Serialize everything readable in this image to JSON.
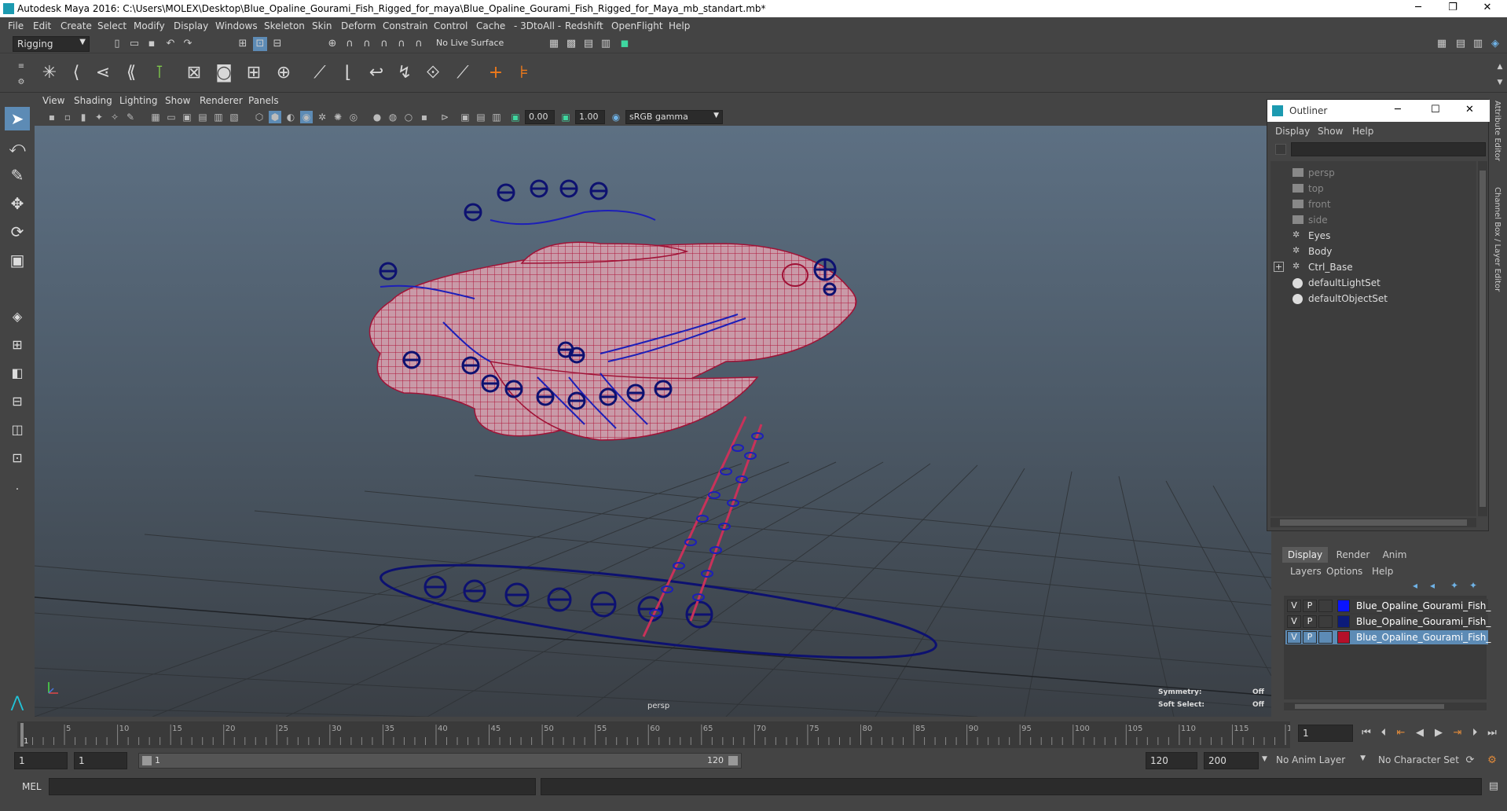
{
  "window": {
    "title": "Autodesk Maya 2016: C:\\Users\\MOLEX\\Desktop\\Blue_Opaline_Gourami_Fish_Rigged_for_maya\\Blue_Opaline_Gourami_Fish_Rigged_for_Maya_mb_standart.mb*",
    "minimize": "─",
    "restore": "❐",
    "close": "✕"
  },
  "menubar": [
    "File",
    "Edit",
    "Create",
    "Select",
    "Modify",
    "Display",
    "Windows",
    "Skeleton",
    "Skin",
    "Deform",
    "Constrain",
    "Control",
    "Cache",
    "- 3DtoAll -",
    "Redshift",
    "OpenFlight",
    "Help"
  ],
  "statusline": {
    "mode": "Rigging",
    "live_surface": "No Live Surface"
  },
  "panel": {
    "menus": [
      "View",
      "Shading",
      "Lighting",
      "Show",
      "Renderer",
      "Panels"
    ],
    "exposure": "0.00",
    "gamma": "1.00",
    "colorspace": "sRGB gamma",
    "camera_label": "persp",
    "symmetry_label": "Symmetry:",
    "symmetry_value": "Off",
    "soft_select_label": "Soft Select:",
    "soft_select_value": "Off"
  },
  "outliner": {
    "title": "Outliner",
    "menus": [
      "Display",
      "Show",
      "Help"
    ],
    "items": [
      {
        "label": "persp",
        "dim": true,
        "icon": "camera-icon"
      },
      {
        "label": "top",
        "dim": true,
        "icon": "camera-icon"
      },
      {
        "label": "front",
        "dim": true,
        "icon": "camera-icon"
      },
      {
        "label": "side",
        "dim": true,
        "icon": "camera-icon"
      },
      {
        "label": "Eyes",
        "dim": false,
        "icon": "mesh-icon"
      },
      {
        "label": "Body",
        "dim": false,
        "icon": "mesh-icon"
      },
      {
        "label": "Ctrl_Base",
        "dim": false,
        "icon": "mesh-icon",
        "expand": "+"
      },
      {
        "label": "defaultLightSet",
        "dim": false,
        "icon": "set-icon"
      },
      {
        "label": "defaultObjectSet",
        "dim": false,
        "icon": "set-icon"
      }
    ]
  },
  "layer_editor": {
    "tabs": [
      "Display",
      "Render",
      "Anim"
    ],
    "menus": [
      "Layers",
      "Options",
      "Help"
    ],
    "layers": [
      {
        "v": "V",
        "p": "P",
        "color": "#0a14ff",
        "name": "Blue_Opaline_Gourami_Fish_Rig",
        "selected": false
      },
      {
        "v": "V",
        "p": "P",
        "color": "#0c1b7a",
        "name": "Blue_Opaline_Gourami_Fish_Rig",
        "selected": false
      },
      {
        "v": "V",
        "p": "P",
        "color": "#b4102a",
        "name": "Blue_Opaline_Gourami_Fish_Rig",
        "selected": true
      }
    ]
  },
  "side_tabs": {
    "attribute_editor": "Attribute Editor",
    "channel_box": "Channel Box / Layer Editor"
  },
  "timeline": {
    "start": 1,
    "end": 120,
    "step": 5,
    "current_frame": "1",
    "first_label": "1"
  },
  "range": {
    "start": "1",
    "playback_start": "1",
    "slider_start": "1",
    "slider_end": "120",
    "playback_end": "120",
    "end": "200",
    "anim_layer": "No Anim Layer",
    "character_set": "No Character Set"
  },
  "command": {
    "language": "MEL"
  }
}
